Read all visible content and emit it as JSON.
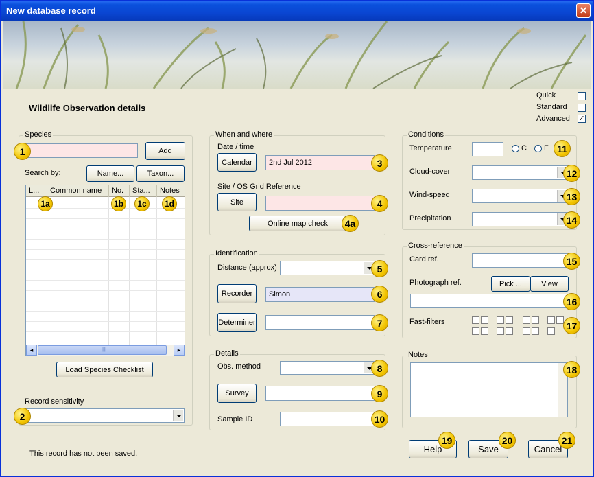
{
  "window": {
    "title": "New database record",
    "close_label": "✕"
  },
  "heading": "Wildlife Observation details",
  "modes": [
    {
      "label": "Quick",
      "checked": false,
      "mark": ""
    },
    {
      "label": "Standard",
      "checked": false,
      "mark": ""
    },
    {
      "label": "Advanced",
      "checked": true,
      "mark": "✓"
    }
  ],
  "species": {
    "title": "Species",
    "input_value": "",
    "add_label": "Add",
    "search_by_label": "Search by:",
    "name_button": "Name...",
    "taxon_button": "Taxon...",
    "columns": [
      "L...",
      "Common name",
      "No.",
      "Sta...",
      "Notes"
    ],
    "load_checklist_label": "Load Species Checklist",
    "scroll_thumb_glyph": "|||",
    "scroll_left": "◂",
    "scroll_right": "▸"
  },
  "sensitivity": {
    "label": "Record sensitivity",
    "value": ""
  },
  "status_text": "This record has not been saved.",
  "when_where": {
    "title": "When and where",
    "date_label": "Date / time",
    "calendar_button": "Calendar",
    "date_value": "2nd Jul 2012",
    "site_label": "Site / OS Grid Reference",
    "site_button": "Site",
    "site_value": "",
    "map_check_button": "Online map check"
  },
  "identification": {
    "title": "Identification",
    "distance_label": "Distance (approx)",
    "distance_value": "",
    "recorder_button": "Recorder",
    "recorder_value": "Simon",
    "determiner_button": "Determiner",
    "determiner_value": ""
  },
  "details": {
    "title": "Details",
    "obs_method_label": "Obs. method",
    "obs_method_value": "",
    "survey_button": "Survey",
    "survey_value": "",
    "sample_id_label": "Sample ID",
    "sample_id_value": ""
  },
  "conditions": {
    "title": "Conditions",
    "temperature_label": "Temperature",
    "temperature_value": "",
    "unit_c": "C",
    "unit_f": "F",
    "cloud_label": "Cloud-cover",
    "cloud_value": "",
    "wind_label": "Wind-speed",
    "wind_value": "",
    "precip_label": "Precipitation",
    "precip_value": ""
  },
  "cross_reference": {
    "title": "Cross-reference",
    "card_ref_label": "Card ref.",
    "card_ref_value": "",
    "photo_ref_label": "Photograph ref.",
    "pick_button": "Pick ...",
    "view_button": "View",
    "photo_ref_value": "",
    "fast_filters_label": "Fast-filters"
  },
  "notes": {
    "title": "Notes",
    "value": ""
  },
  "buttons": {
    "help": "Help",
    "save": "Save",
    "cancel": "Cancel"
  },
  "badges": {
    "b1": "1",
    "b1a": "1a",
    "b1b": "1b",
    "b1c": "1c",
    "b1d": "1d",
    "b2": "2",
    "b3": "3",
    "b4": "4",
    "b4a": "4a",
    "b5": "5",
    "b6": "6",
    "b7": "7",
    "b8": "8",
    "b9": "9",
    "b10": "10",
    "b11": "11",
    "b12": "12",
    "b13": "13",
    "b14": "14",
    "b15": "15",
    "b16": "16",
    "b17": "17",
    "b18": "18",
    "b19": "19",
    "b20": "20",
    "b21": "21"
  },
  "colors": {
    "titlebar": "#0a46d2",
    "window_bg": "#ece9d8",
    "required_field": "#fde6e6",
    "filled_field": "#e6e6f8",
    "badge": "#f2c400"
  }
}
